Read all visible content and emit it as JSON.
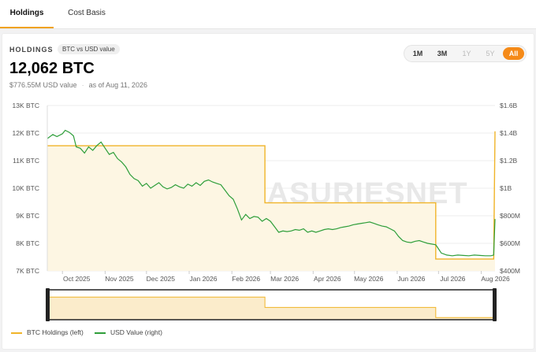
{
  "tabs": [
    {
      "label": "Holdings",
      "active": true
    },
    {
      "label": "Cost Basis",
      "active": false
    }
  ],
  "header": {
    "label": "HOLDINGS",
    "pill": "BTC vs USD value",
    "value": "12,062 BTC",
    "usd": "$776.55M USD value",
    "asof": "as of Aug 11, 2026"
  },
  "ranges": [
    {
      "label": "1M",
      "state": "enabled"
    },
    {
      "label": "3M",
      "state": "enabled"
    },
    {
      "label": "1Y",
      "state": "disabled"
    },
    {
      "label": "5Y",
      "state": "disabled"
    },
    {
      "label": "All",
      "state": "selected"
    }
  ],
  "watermark": "BITCOINTREASURIESNET",
  "legend": [
    {
      "label": "BTC Holdings (left)",
      "color": "#f0b429"
    },
    {
      "label": "USD Value (right)",
      "color": "#2e9e3a"
    }
  ],
  "colors": {
    "accent": "#f58a18",
    "btc": "#f0b429",
    "usd": "#2e9e3a",
    "fill": "#fdf6e3"
  },
  "chart_data": {
    "type": "line",
    "x_ticks": [
      "Oct 2025",
      "Nov 2025",
      "Dec 2025",
      "Jan 2026",
      "Feb 2026",
      "Mar 2026",
      "Apr 2026",
      "May 2026",
      "Jun 2026",
      "Jul 2026",
      "Aug 2026"
    ],
    "y_left": {
      "ticks": [
        "7K BTC",
        "8K BTC",
        "9K BTC",
        "10K BTC",
        "11K BTC",
        "12K BTC",
        "13K BTC"
      ],
      "range": [
        7000,
        13000
      ]
    },
    "y_right": {
      "ticks": [
        "$400M",
        "$600M",
        "$800M",
        "$1B",
        "$1.2B",
        "$1.4B",
        "$1.6B"
      ],
      "range": [
        400,
        1600
      ],
      "unit": "USD millions"
    },
    "series": [
      {
        "name": "BTC Holdings (left)",
        "axis": "left",
        "style": "step-area",
        "points": [
          [
            "2025-09-20",
            11540
          ],
          [
            "2025-10-31",
            11540
          ],
          [
            "2025-11-30",
            11540
          ],
          [
            "2026-01-31",
            11540
          ],
          [
            "2026-02-25",
            11540
          ],
          [
            "2026-02-25",
            9470
          ],
          [
            "2026-03-31",
            9470
          ],
          [
            "2026-05-31",
            9470
          ],
          [
            "2026-06-29",
            9470
          ],
          [
            "2026-06-29",
            7430
          ],
          [
            "2026-07-31",
            7430
          ],
          [
            "2026-08-10",
            7430
          ],
          [
            "2026-08-11",
            12062
          ]
        ]
      },
      {
        "name": "USD Value (right)",
        "axis": "right",
        "style": "line",
        "points": [
          [
            "2025-09-20",
            1360
          ],
          [
            "2025-09-24",
            1390
          ],
          [
            "2025-09-27",
            1375
          ],
          [
            "2025-10-01",
            1395
          ],
          [
            "2025-10-03",
            1420
          ],
          [
            "2025-10-06",
            1405
          ],
          [
            "2025-10-09",
            1380
          ],
          [
            "2025-10-11",
            1300
          ],
          [
            "2025-10-14",
            1290
          ],
          [
            "2025-10-17",
            1255
          ],
          [
            "2025-10-20",
            1300
          ],
          [
            "2025-10-23",
            1275
          ],
          [
            "2025-10-26",
            1310
          ],
          [
            "2025-10-29",
            1335
          ],
          [
            "2025-11-01",
            1290
          ],
          [
            "2025-11-04",
            1245
          ],
          [
            "2025-11-07",
            1260
          ],
          [
            "2025-11-10",
            1215
          ],
          [
            "2025-11-13",
            1190
          ],
          [
            "2025-11-16",
            1155
          ],
          [
            "2025-11-19",
            1100
          ],
          [
            "2025-11-22",
            1070
          ],
          [
            "2025-11-25",
            1055
          ],
          [
            "2025-11-28",
            1015
          ],
          [
            "2025-12-01",
            1035
          ],
          [
            "2025-12-04",
            1000
          ],
          [
            "2025-12-07",
            1020
          ],
          [
            "2025-12-10",
            1040
          ],
          [
            "2025-12-13",
            1010
          ],
          [
            "2025-12-16",
            995
          ],
          [
            "2025-12-19",
            1005
          ],
          [
            "2025-12-22",
            1025
          ],
          [
            "2025-12-25",
            1010
          ],
          [
            "2025-12-28",
            1000
          ],
          [
            "2025-12-31",
            1030
          ],
          [
            "2026-01-03",
            1015
          ],
          [
            "2026-01-06",
            1040
          ],
          [
            "2026-01-09",
            1020
          ],
          [
            "2026-01-12",
            1050
          ],
          [
            "2026-01-15",
            1060
          ],
          [
            "2026-01-18",
            1045
          ],
          [
            "2026-01-21",
            1035
          ],
          [
            "2026-01-24",
            1025
          ],
          [
            "2026-01-27",
            985
          ],
          [
            "2026-01-30",
            945
          ],
          [
            "2026-02-02",
            920
          ],
          [
            "2026-02-05",
            850
          ],
          [
            "2026-02-08",
            770
          ],
          [
            "2026-02-11",
            810
          ],
          [
            "2026-02-14",
            780
          ],
          [
            "2026-02-17",
            795
          ],
          [
            "2026-02-20",
            790
          ],
          [
            "2026-02-23",
            760
          ],
          [
            "2026-02-26",
            780
          ],
          [
            "2026-03-01",
            760
          ],
          [
            "2026-03-04",
            720
          ],
          [
            "2026-03-07",
            680
          ],
          [
            "2026-03-10",
            690
          ],
          [
            "2026-03-13",
            685
          ],
          [
            "2026-03-16",
            690
          ],
          [
            "2026-03-19",
            700
          ],
          [
            "2026-03-22",
            695
          ],
          [
            "2026-03-25",
            705
          ],
          [
            "2026-03-28",
            680
          ],
          [
            "2026-03-31",
            690
          ],
          [
            "2026-04-03",
            680
          ],
          [
            "2026-04-06",
            690
          ],
          [
            "2026-04-09",
            700
          ],
          [
            "2026-04-12",
            705
          ],
          [
            "2026-04-15",
            700
          ],
          [
            "2026-04-18",
            705
          ],
          [
            "2026-04-21",
            715
          ],
          [
            "2026-04-24",
            720
          ],
          [
            "2026-04-27",
            725
          ],
          [
            "2026-04-30",
            735
          ],
          [
            "2026-05-03",
            740
          ],
          [
            "2026-05-06",
            745
          ],
          [
            "2026-05-09",
            750
          ],
          [
            "2026-05-12",
            755
          ],
          [
            "2026-05-15",
            745
          ],
          [
            "2026-05-18",
            735
          ],
          [
            "2026-05-21",
            725
          ],
          [
            "2026-05-24",
            720
          ],
          [
            "2026-05-27",
            705
          ],
          [
            "2026-05-30",
            690
          ],
          [
            "2026-06-02",
            650
          ],
          [
            "2026-06-05",
            620
          ],
          [
            "2026-06-08",
            610
          ],
          [
            "2026-06-11",
            605
          ],
          [
            "2026-06-14",
            615
          ],
          [
            "2026-06-17",
            620
          ],
          [
            "2026-06-20",
            610
          ],
          [
            "2026-06-23",
            600
          ],
          [
            "2026-06-26",
            595
          ],
          [
            "2026-06-29",
            590
          ],
          [
            "2026-07-01",
            560
          ],
          [
            "2026-07-03",
            530
          ],
          [
            "2026-07-07",
            515
          ],
          [
            "2026-07-11",
            510
          ],
          [
            "2026-07-15",
            515
          ],
          [
            "2026-07-19",
            512
          ],
          [
            "2026-07-23",
            510
          ],
          [
            "2026-07-27",
            515
          ],
          [
            "2026-07-31",
            512
          ],
          [
            "2026-08-04",
            510
          ],
          [
            "2026-08-08",
            510
          ],
          [
            "2026-08-10",
            515
          ],
          [
            "2026-08-11",
            776.55
          ]
        ]
      }
    ],
    "navigator": {
      "series": "BTC Holdings (left)",
      "selection": "all"
    },
    "grid": true,
    "legend_position": "bottom-left"
  }
}
